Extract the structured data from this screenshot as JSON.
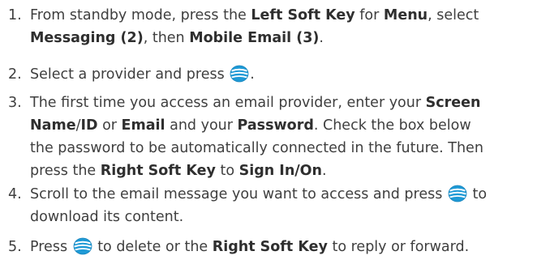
{
  "icons": {
    "nav_key": "globe-nav-key-icon",
    "nav_key_color": "#1f9ad6"
  },
  "steps": [
    {
      "number": "1.",
      "line1": {
        "t1": "From standby mode, press the ",
        "b1": "Left Soft Key",
        "t2": " for ",
        "b2": "Menu",
        "t3": ", select"
      },
      "line2": {
        "b1": "Messaging (2)",
        "t1": ", then ",
        "b2": "Mobile Email (3)",
        "t2": "."
      }
    },
    {
      "number": "2.",
      "line1": {
        "t1": "Select a provider and press ",
        "t2": "."
      }
    },
    {
      "number": "3.",
      "line1": {
        "t1": "The first time you access an email provider, enter your ",
        "b1": "Screen"
      },
      "line2": {
        "b1": "Name",
        "t1": "/",
        "b2": "ID",
        "t2": " or ",
        "b3": "Email",
        "t3": " and your ",
        "b4": "Password",
        "t4": ". Check the box below"
      },
      "line3": {
        "t1": "the password to be automatically connected in the future. Then"
      },
      "line4": {
        "t1": "press the ",
        "b1": "Right Soft Key",
        "t2": " to ",
        "b2": "Sign In/On",
        "t3": "."
      }
    },
    {
      "number": "4.",
      "line1": {
        "t1": "Scroll to the email message you want to access and press ",
        "t2": " to"
      },
      "line2": {
        "t1": "download its content."
      }
    },
    {
      "number": "5.",
      "line1": {
        "t1": "Press ",
        "t2": " to delete or the ",
        "b1": "Right Soft Key",
        "t3": " to reply or forward."
      }
    }
  ]
}
